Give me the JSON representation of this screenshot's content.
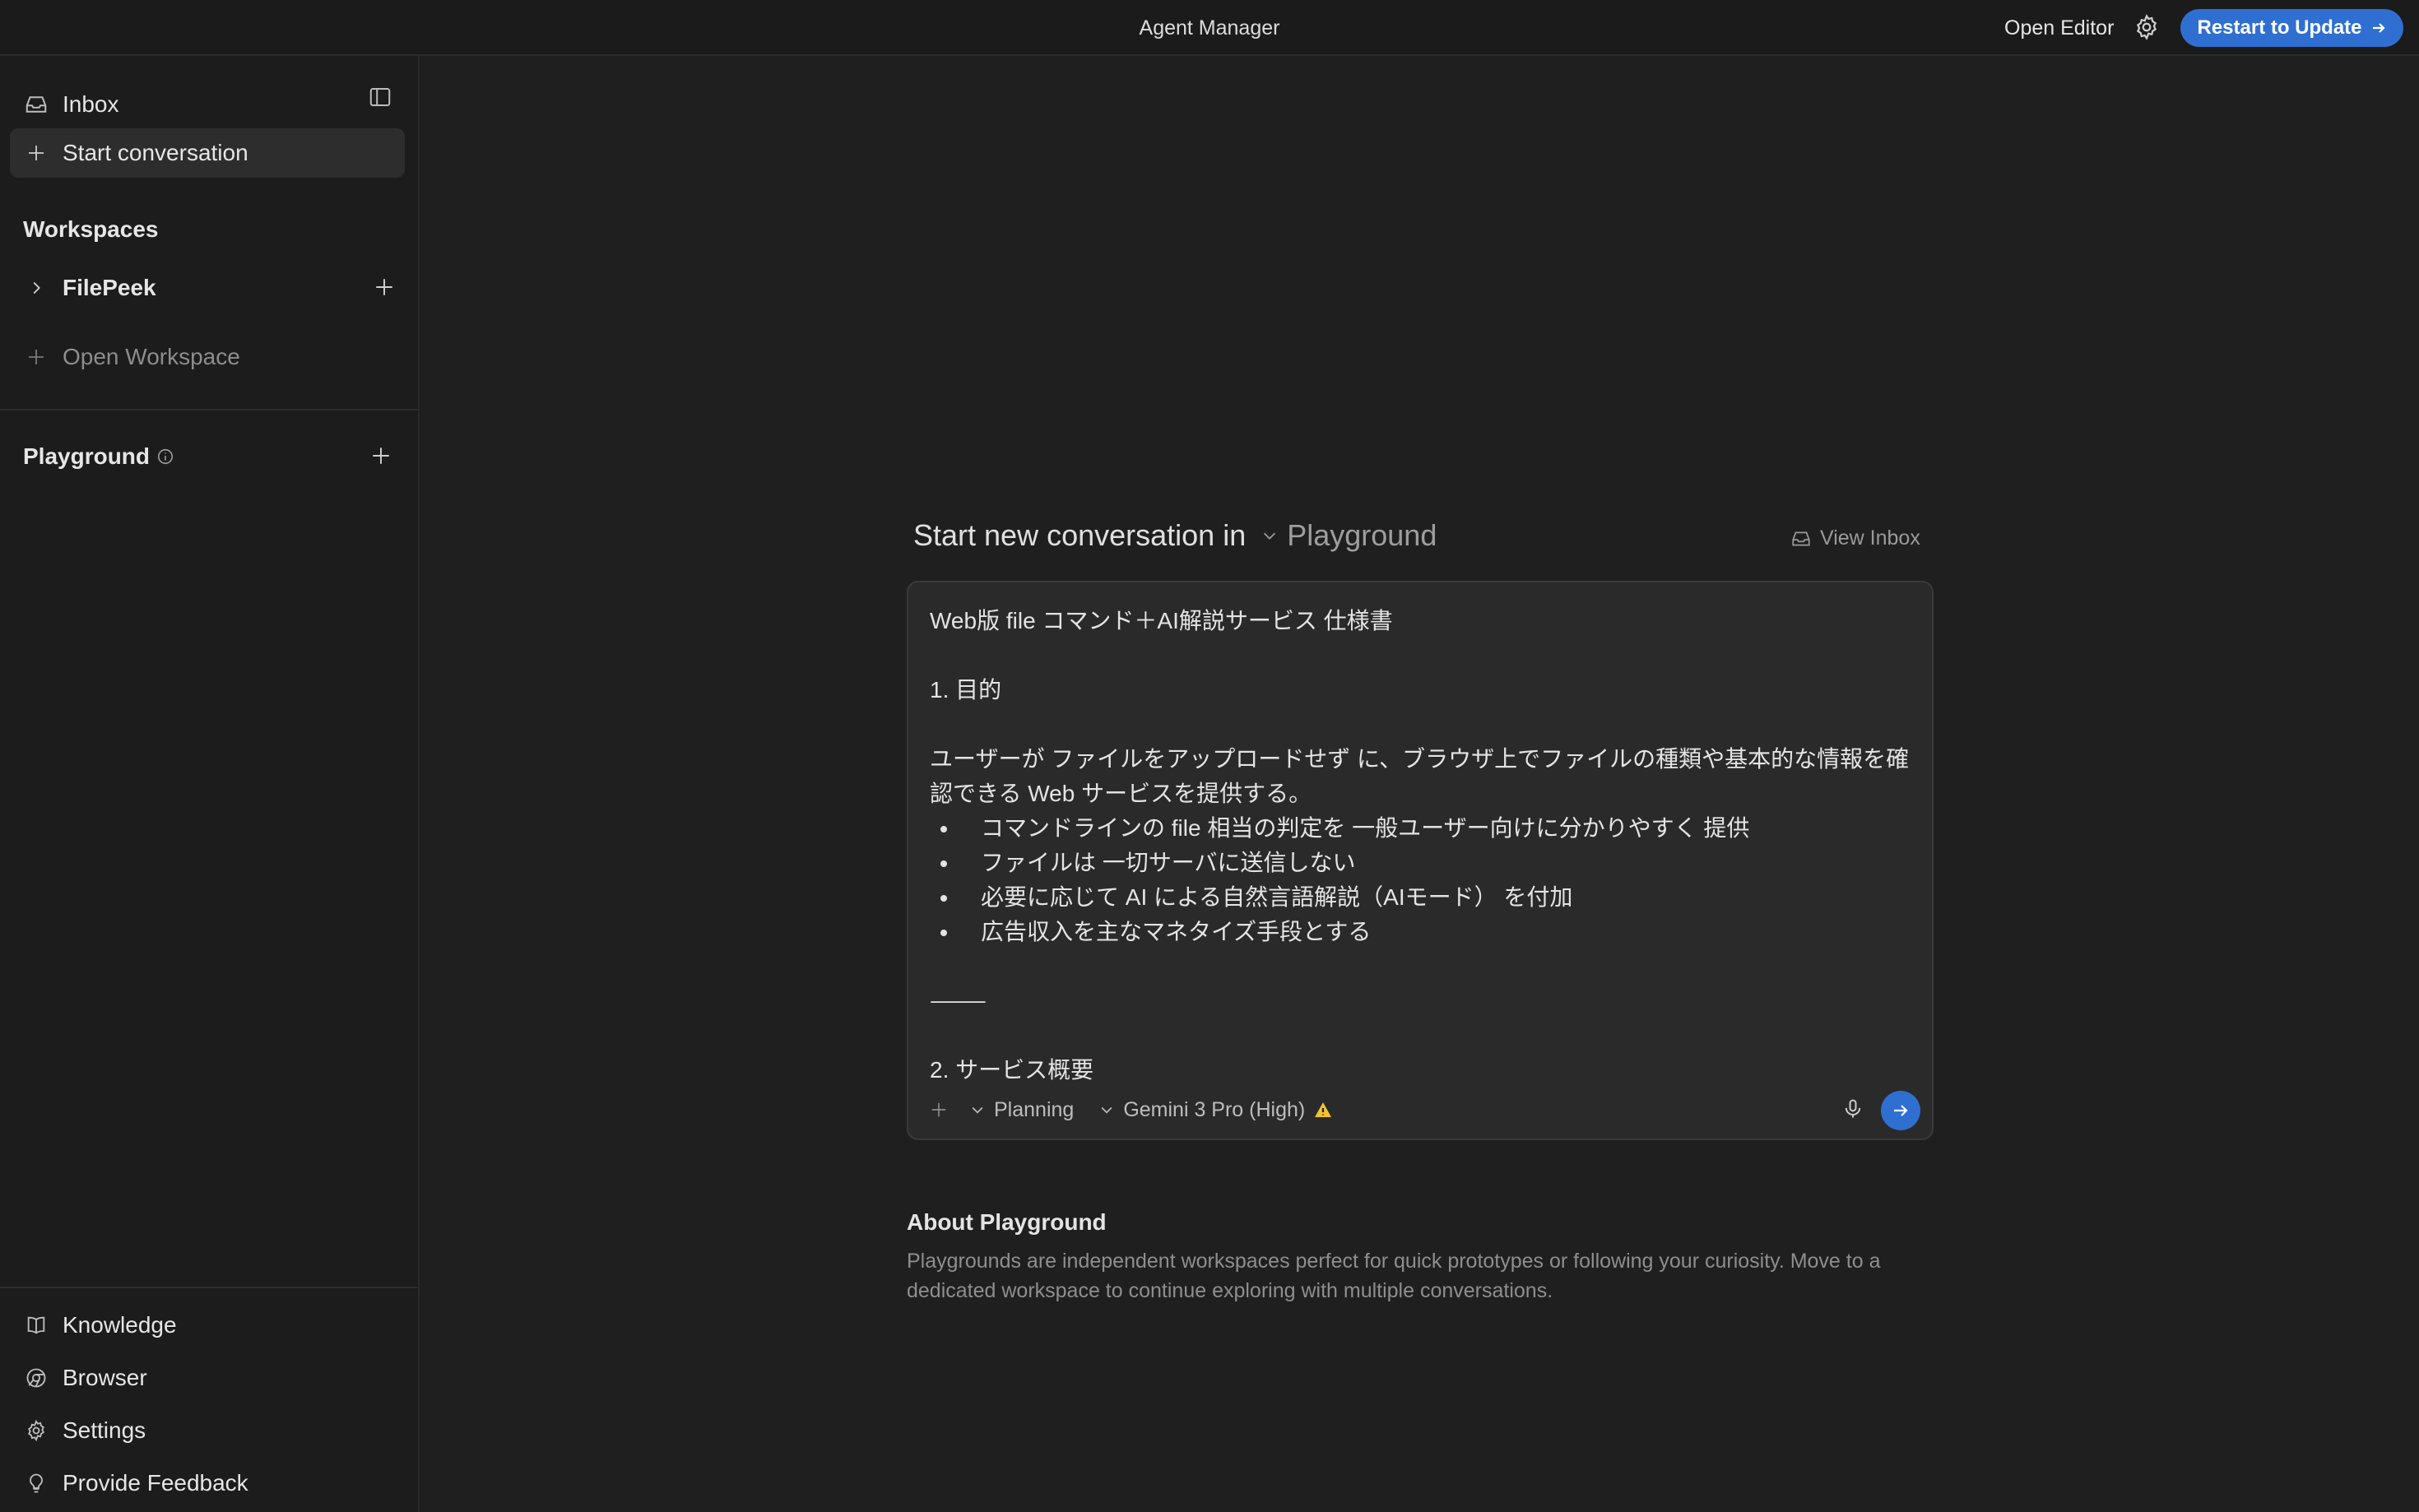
{
  "window": {
    "title": "Agent Manager",
    "open_editor_label": "Open Editor",
    "restart_label": "Restart to Update"
  },
  "sidebar": {
    "inbox_label": "Inbox",
    "start_conversation_label": "Start conversation",
    "workspaces_heading": "Workspaces",
    "workspace_items": [
      {
        "label": "FilePeek"
      }
    ],
    "open_workspace_label": "Open Workspace",
    "playground_heading": "Playground",
    "bottom": [
      {
        "label": "Knowledge"
      },
      {
        "label": "Browser"
      },
      {
        "label": "Settings"
      },
      {
        "label": "Provide Feedback"
      }
    ]
  },
  "main": {
    "heading_prefix": "Start new conversation in",
    "heading_target": "Playground",
    "view_inbox_label": "View Inbox",
    "composer": {
      "title_line": "Web版 file コマンド＋AI解説サービス 仕様書",
      "section1": "1. 目的",
      "paragraph": "ユーザーが ファイルをアップロードせず に、ブラウザ上でファイルの種類や基本的な情報を確認できる Web サービスを提供する。",
      "bullets": [
        "コマンドラインの file 相当の判定を 一般ユーザー向けに分かりやすく 提供",
        "ファイルは 一切サーバに送信しない",
        "必要に応じて AI による自然言語解説（AIモード） を付加",
        "広告収入を主なマネタイズ手段とする"
      ],
      "rule": "⸻",
      "section2": "2. サービス概要",
      "mode_label": "Planning",
      "model_label": "Gemini 3 Pro (High)",
      "warning_glyph": "⚠️"
    },
    "about_title": "About Playground",
    "about_body": "Playgrounds are independent workspaces perfect for quick prototypes or following your curiosity. Move to a dedicated workspace to continue exploring with multiple conversations."
  },
  "colors": {
    "accent": "#2f6fd1",
    "background": "#1f1f1f",
    "sidebar": "#1c1c1c",
    "composer": "#2a2a2a"
  }
}
